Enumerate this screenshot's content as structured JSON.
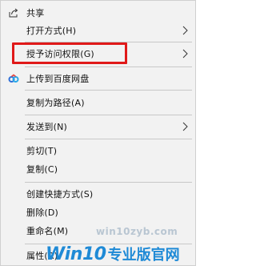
{
  "context_menu": {
    "items": [
      {
        "label": "共享",
        "icon": "share-icon",
        "submenu": false
      },
      {
        "label": "打开方式(H)",
        "submenu": true
      },
      {
        "label": "授予访问权限(G)",
        "submenu": true,
        "highlighted": true
      },
      {
        "label": "上传到百度网盘",
        "icon": "baidu-netdisk-icon",
        "submenu": false
      },
      {
        "label": "复制为路径(A)",
        "submenu": false
      },
      {
        "label": "发送到(N)",
        "submenu": true
      },
      {
        "label": "剪切(T)",
        "submenu": false
      },
      {
        "label": "复制(C)",
        "submenu": false
      },
      {
        "label": "创建快捷方式(S)",
        "submenu": false
      },
      {
        "label": "删除(D)",
        "submenu": false
      },
      {
        "label": "重命名(M)",
        "submenu": false
      },
      {
        "label": "属性(R)",
        "submenu": false
      }
    ]
  },
  "highlight_color": "#e01919",
  "watermark": {
    "url": "win10zyb.com",
    "logo_win": "Win10",
    "logo_cn": "专业版官网"
  }
}
